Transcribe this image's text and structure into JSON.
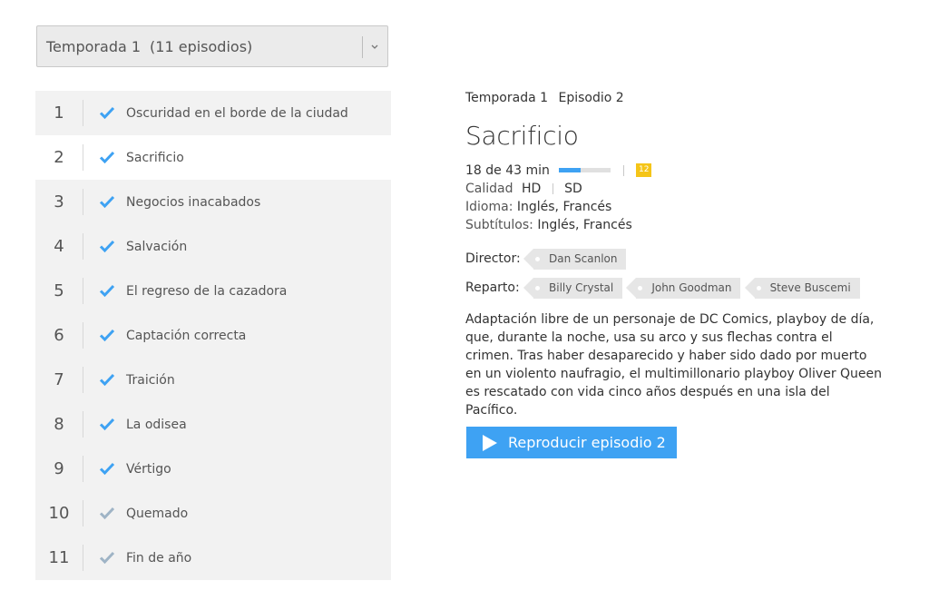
{
  "season_select": {
    "label": "Temporada 1",
    "count": "(11 episodios)"
  },
  "episodes": [
    {
      "num": "1",
      "title": "Oscuridad en el borde de la ciudad",
      "watched": "full"
    },
    {
      "num": "2",
      "title": "Sacrificio",
      "watched": "full"
    },
    {
      "num": "3",
      "title": "Negocios inacabados",
      "watched": "full"
    },
    {
      "num": "4",
      "title": "Salvación",
      "watched": "full"
    },
    {
      "num": "5",
      "title": "El regreso de la cazadora",
      "watched": "full"
    },
    {
      "num": "6",
      "title": "Captación correcta",
      "watched": "full"
    },
    {
      "num": "7",
      "title": "Traición",
      "watched": "full"
    },
    {
      "num": "8",
      "title": "La odisea",
      "watched": "full"
    },
    {
      "num": "9",
      "title": "Vértigo",
      "watched": "full"
    },
    {
      "num": "10",
      "title": "Quemado",
      "watched": "partial"
    },
    {
      "num": "11",
      "title": "Fin de año",
      "watched": "partial"
    }
  ],
  "active_episode_index": 1,
  "detail": {
    "season_label": "Temporada",
    "season_num": "1",
    "episode_label": "Episodio",
    "episode_num": "2",
    "title": "Sacrificio",
    "progress_text": "18 de 43 min",
    "progress_fraction": 0.42,
    "rating": "12",
    "quality_label": "Calidad",
    "quality_hd": "HD",
    "quality_sd": "SD",
    "language_label": "Idioma:",
    "language_value": "Inglés, Francés",
    "subtitles_label": "Subtítulos:",
    "subtitles_value": "Inglés, Francés",
    "director_label": "Director:",
    "director": "Dan Scanlon",
    "cast_label": "Reparto:",
    "cast": [
      "Billy Crystal",
      "John Goodman",
      "Steve Buscemi"
    ],
    "synopsis": "Adaptación libre de un personaje de DC Comics, playboy de día, que, durante la noche, usa su arco y sus flechas contra el crimen. Tras haber desaparecido y haber sido dado por muerto en un violento naufragio, el multimillonario playboy Oliver Queen es rescatado con vida cinco años después en una isla del Pacífico.",
    "play_label": "Reproducir episodio 2"
  },
  "colors": {
    "accent": "#3ea2f3",
    "check_full": "#3ea2f3",
    "check_partial": "#9fb4c6",
    "rating_bg": "#f5c518",
    "row_bg": "#f2f2f2"
  }
}
